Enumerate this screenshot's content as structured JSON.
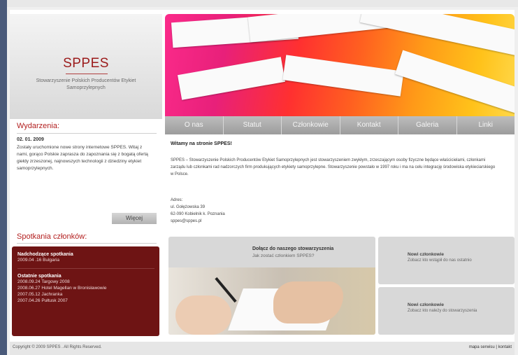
{
  "logo": {
    "title": "SPPES",
    "subtitle": "Stowarzyszenie Polskich Producentów Etykiet Samoprzylepnych"
  },
  "nav": [
    {
      "label": "O nas"
    },
    {
      "label": "Statut"
    },
    {
      "label": "Członkowie"
    },
    {
      "label": "Kontakt"
    },
    {
      "label": "Galeria"
    },
    {
      "label": "Linki"
    }
  ],
  "events": {
    "title": "Wydarzenia:",
    "date": "02. 01. 2009",
    "text": "Zostały uruchomione nowe strony internetowe SPPES. Witaj z nami, gorąco Polskie zaprasza do zapoznania się z bogatą ofertą giełdy zrzeszonej, najnowszych technologii z dziedziny etykiet samoprzylepnych.",
    "more_button": "Więcej"
  },
  "meetings": {
    "title": "Spotkania członków:",
    "upcoming_label": "Nadchodzące spotkania",
    "upcoming": [
      "2009.04 .16 Bulgaria"
    ],
    "recent_label": "Ostatnie spotkania",
    "recent": [
      "2008.09.24 Targowy 2008",
      "2008.06.27 Hotel Magellan w Bronisławowie",
      "2007.05.12 Jachranka",
      "2007.04.26 Pułtusk 2007"
    ]
  },
  "content": {
    "welcome": "Witamy na stronie SPPES!",
    "intro": "SPPES – Stowarzyszenie Polskich Producentów Etykiet Samoprzylepnych jest stowarzyszeniem zwykłym, zrzeszającym osoby fizyczne będące właścicielami, członkami zarządu lub członkami rad nadzorczych firm produkujących etykiety samoprzylepne. Stowarzyszenie powstało w 1997 roku i ma na celu integrację środowiska etykieciarskiego w Polsce.",
    "address_label": "Adres:",
    "address_street": "ul. Gołężowska 39",
    "address_city": "62-090 Kobielnik k. Poznania",
    "address_email": "sppes@sppes.pl"
  },
  "boxes": {
    "join_title": "Dołącz do naszego stowarzyszenia",
    "join_sub": "Jak zostać członkiem SPPES?",
    "members_title": "Nowi członkowie",
    "members_sub": "Zobacz kto wstąpił do nas ostatnio",
    "member_title": "Nowi członkowie",
    "member_sub": "Zobacz kto należy do stowarzyszenia"
  },
  "footer": {
    "copyright": "Copyright © 2009 SPPES . All Rights Reserved.",
    "sitemap": "mapa serwisu",
    "separator": "|",
    "contact": "kontakt"
  },
  "colors": {
    "brand": "#9b1a1a",
    "meetings_bg": "#6e1414",
    "nav_bg": "#a8a8a8"
  }
}
